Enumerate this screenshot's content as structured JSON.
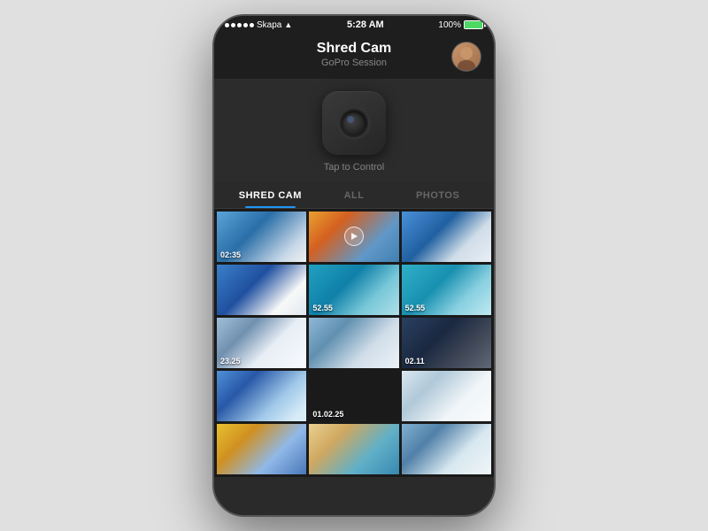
{
  "statusBar": {
    "carrier": "Skapa",
    "time": "5:28 AM",
    "battery": "100%"
  },
  "header": {
    "title": "Shred Cam",
    "subtitle": "GoPro Session"
  },
  "camera": {
    "tapLabel": "Tap to Control"
  },
  "tabs": [
    {
      "id": "shred-cam",
      "label": "SHRED CAM",
      "active": true
    },
    {
      "id": "all",
      "label": "ALL",
      "active": false
    },
    {
      "id": "photos",
      "label": "PHOTOS",
      "active": false
    }
  ],
  "thumbnails": [
    {
      "id": 1,
      "duration": "02:35",
      "scene": "scene-ski-blue",
      "hasPlay": false
    },
    {
      "id": 2,
      "duration": "",
      "scene": "scene-orange-sky",
      "hasPlay": true
    },
    {
      "id": 3,
      "duration": "",
      "scene": "scene-mountain-blue",
      "hasPlay": false
    },
    {
      "id": 4,
      "duration": "",
      "scene": "scene-blue-action",
      "hasPlay": false
    },
    {
      "id": 5,
      "duration": "52.55",
      "scene": "scene-surf-cyan",
      "hasPlay": false
    },
    {
      "id": 6,
      "duration": "52.55",
      "scene": "scene-surf-cyan2",
      "hasPlay": false
    },
    {
      "id": 7,
      "duration": "23.25",
      "scene": "scene-snow-white",
      "hasPlay": false
    },
    {
      "id": 8,
      "duration": "",
      "scene": "scene-snow-action",
      "hasPlay": false
    },
    {
      "id": 9,
      "duration": "02.11",
      "scene": "scene-dark-person",
      "hasPlay": false
    },
    {
      "id": 10,
      "duration": "",
      "scene": "scene-sky-dive",
      "hasPlay": false
    },
    {
      "id": 11,
      "duration": "01.02.25",
      "scene": "scene-underwater",
      "hasPlay": false
    },
    {
      "id": 12,
      "duration": "",
      "scene": "scene-snow-bright",
      "hasPlay": false
    },
    {
      "id": 13,
      "duration": "",
      "scene": "scene-sunrise",
      "hasPlay": false
    },
    {
      "id": 14,
      "duration": "",
      "scene": "scene-yoga",
      "hasPlay": false
    },
    {
      "id": 15,
      "duration": "",
      "scene": "scene-snowboard",
      "hasPlay": false
    }
  ]
}
